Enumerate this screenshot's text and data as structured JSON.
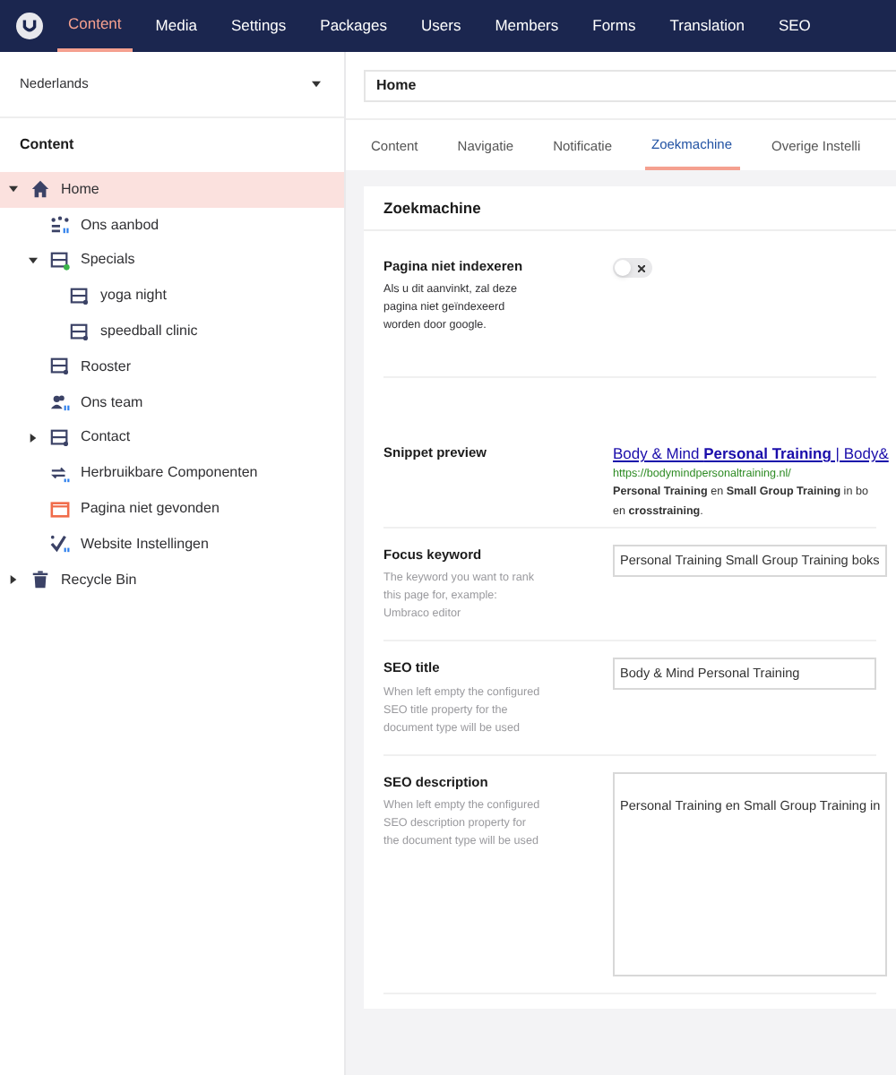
{
  "top_nav": [
    {
      "label": "Content",
      "selected": true
    },
    {
      "label": "Media",
      "selected": false
    },
    {
      "label": "Settings",
      "selected": false
    },
    {
      "label": "Packages",
      "selected": false
    },
    {
      "label": "Users",
      "selected": false
    },
    {
      "label": "Members",
      "selected": false
    },
    {
      "label": "Forms",
      "selected": false
    },
    {
      "label": "Translation",
      "selected": false
    },
    {
      "label": "SEO",
      "selected": false
    }
  ],
  "sidebar": {
    "language": "Nederlands",
    "section_title": "Content",
    "tree": [
      {
        "label": "Home",
        "kind": "home",
        "selected": true,
        "expanded": true,
        "children": [
          {
            "label": "Ons aanbod",
            "kind": "grid",
            "selected": false
          },
          {
            "label": "Specials",
            "kind": "folder",
            "selected": false,
            "expanded": true,
            "children": [
              {
                "label": "yoga night",
                "kind": "page",
                "selected": false
              },
              {
                "label": "speedball clinic",
                "kind": "page",
                "selected": false
              }
            ]
          },
          {
            "label": "Rooster",
            "kind": "page",
            "selected": false
          },
          {
            "label": "Ons team",
            "kind": "team",
            "selected": false
          },
          {
            "label": "Contact",
            "kind": "page",
            "selected": false,
            "expanded": false
          },
          {
            "label": "Herbruikbare Componenten",
            "kind": "reuse",
            "selected": false
          },
          {
            "label": "Pagina niet gevonden",
            "kind": "error",
            "selected": false
          },
          {
            "label": "Website Instellingen",
            "kind": "settings",
            "selected": false
          }
        ]
      },
      {
        "label": "Recycle Bin",
        "kind": "bin",
        "selected": false,
        "expanded": false
      }
    ]
  },
  "editor": {
    "name": "Home",
    "tabs": [
      {
        "label": "Content",
        "selected": false
      },
      {
        "label": "Navigatie",
        "selected": false
      },
      {
        "label": "Notificatie",
        "selected": false
      },
      {
        "label": "Zoekmachine",
        "selected": true
      },
      {
        "label": "Overige Instelli",
        "selected": false
      }
    ],
    "panel_title": "Zoekmachine",
    "properties": [
      {
        "kind": "toggle",
        "label": "Pagina niet indexeren",
        "description": "Als u dit aanvinkt, zal deze pagina niet geïndexeerd worden door google.",
        "on": false
      },
      {
        "kind": "snippet",
        "label": "Snippet preview",
        "title": "Body & Mind **Personal Training** | Body&",
        "url": "https://bodymindpersonaltraining.nl/",
        "text": "**Personal Training** en **Small Group Training** in bo en **crosstraining**."
      },
      {
        "kind": "text",
        "label": "Focus keyword",
        "description": "The keyword you want to rank this page for, example: Umbraco editor",
        "value": "Personal Training Small Group Training boks"
      },
      {
        "kind": "text",
        "label": "SEO title",
        "description": "When left empty the configured SEO title property for the document type will be used",
        "value": "Body & Mind Personal Training"
      },
      {
        "kind": "textarea",
        "label": "SEO description",
        "description": "When left empty the configured SEO description property for the document type will be used",
        "value": "Personal Training en Small Group Training in"
      }
    ]
  }
}
